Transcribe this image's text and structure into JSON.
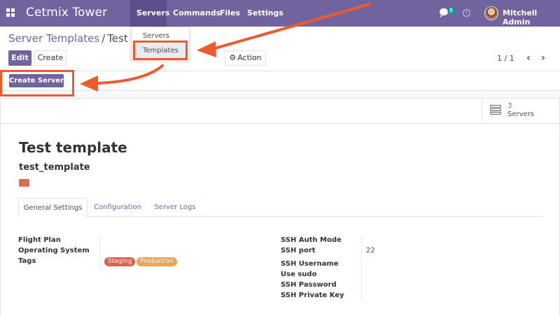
{
  "navbar": {
    "brand": "Cetmix Tower",
    "menus": [
      "Servers",
      "Commands",
      "Files",
      "Settings"
    ],
    "chat_badge": "5",
    "user_name": "Mitchell Admin"
  },
  "dropdown": {
    "items": [
      "Servers",
      "Templates"
    ]
  },
  "control_panel": {
    "breadcrumb_parent": "Server Templates",
    "breadcrumb_separator": "/",
    "breadcrumb_current": "Test te",
    "edit_label": "Edit",
    "create_label": "Create",
    "action_label": "Action",
    "pager": "1 / 1",
    "prev_glyph": "‹",
    "next_glyph": "›"
  },
  "form_header": {
    "create_server_label": "Create Server"
  },
  "smart_button": {
    "count": "3",
    "label": "Servers"
  },
  "record": {
    "title": "Test template",
    "reference": "test_template",
    "color": "#e06c56"
  },
  "tabs": [
    "General Settings",
    "Configuration",
    "Server Logs"
  ],
  "fields_left": {
    "flight_plan": "Flight Plan",
    "operating_system": "Operating System",
    "tags": "Tags"
  },
  "tags": [
    {
      "label": "Staging",
      "color": "#d9604f"
    },
    {
      "label": "Production",
      "color": "#e8a55a"
    }
  ],
  "fields_right": {
    "ssh_auth_mode": "SSH Auth Mode",
    "ssh_port": "SSH port",
    "ssh_port_value": "22",
    "ssh_username": "SSH Username",
    "use_sudo": "Use sudo",
    "ssh_password": "SSH Password",
    "ssh_private_key": "SSH Private Key"
  },
  "colors": {
    "navbar": "#71639e",
    "annotation": "#ee5a2e"
  },
  "icons": [
    "apps-icon",
    "chat-icon",
    "clock-icon",
    "gear-icon",
    "servers-icon"
  ]
}
